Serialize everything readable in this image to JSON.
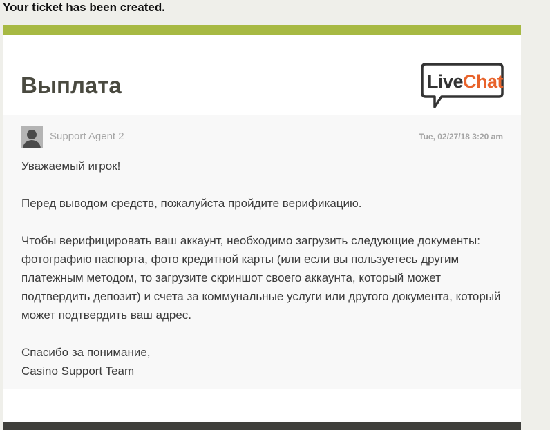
{
  "notice": "Your ticket has been created.",
  "ticket": {
    "title": "Выплата",
    "logo_text_live": "Live",
    "logo_text_chat": "Chat"
  },
  "message": {
    "agent": "Support Agent 2",
    "timestamp": "Tue, 02/27/18 3:20 am",
    "greeting": "Уважаемый игрок!",
    "paragraph1": "Перед выводом средств, пожалуйста пройдите верификацию.",
    "paragraph2": "Чтобы верифицировать ваш аккаунт, необходимо загрузить следующие документы: фотографию паспорта, фото кредитной карты (или если вы пользуетесь другим платежным методом, то загрузите скриншот своего аккаунта, который может подтвердить депозит) и счета за коммунальные услуги или другого документа, который может подтвердить ваш адрес.",
    "closing": "Спасибо за понимание,",
    "signature": "Casino Support Team"
  },
  "colors": {
    "accent": "#a7b943",
    "logo_orange": "#e8632b",
    "logo_dark": "#333333",
    "footer": "#3f3f3b"
  }
}
